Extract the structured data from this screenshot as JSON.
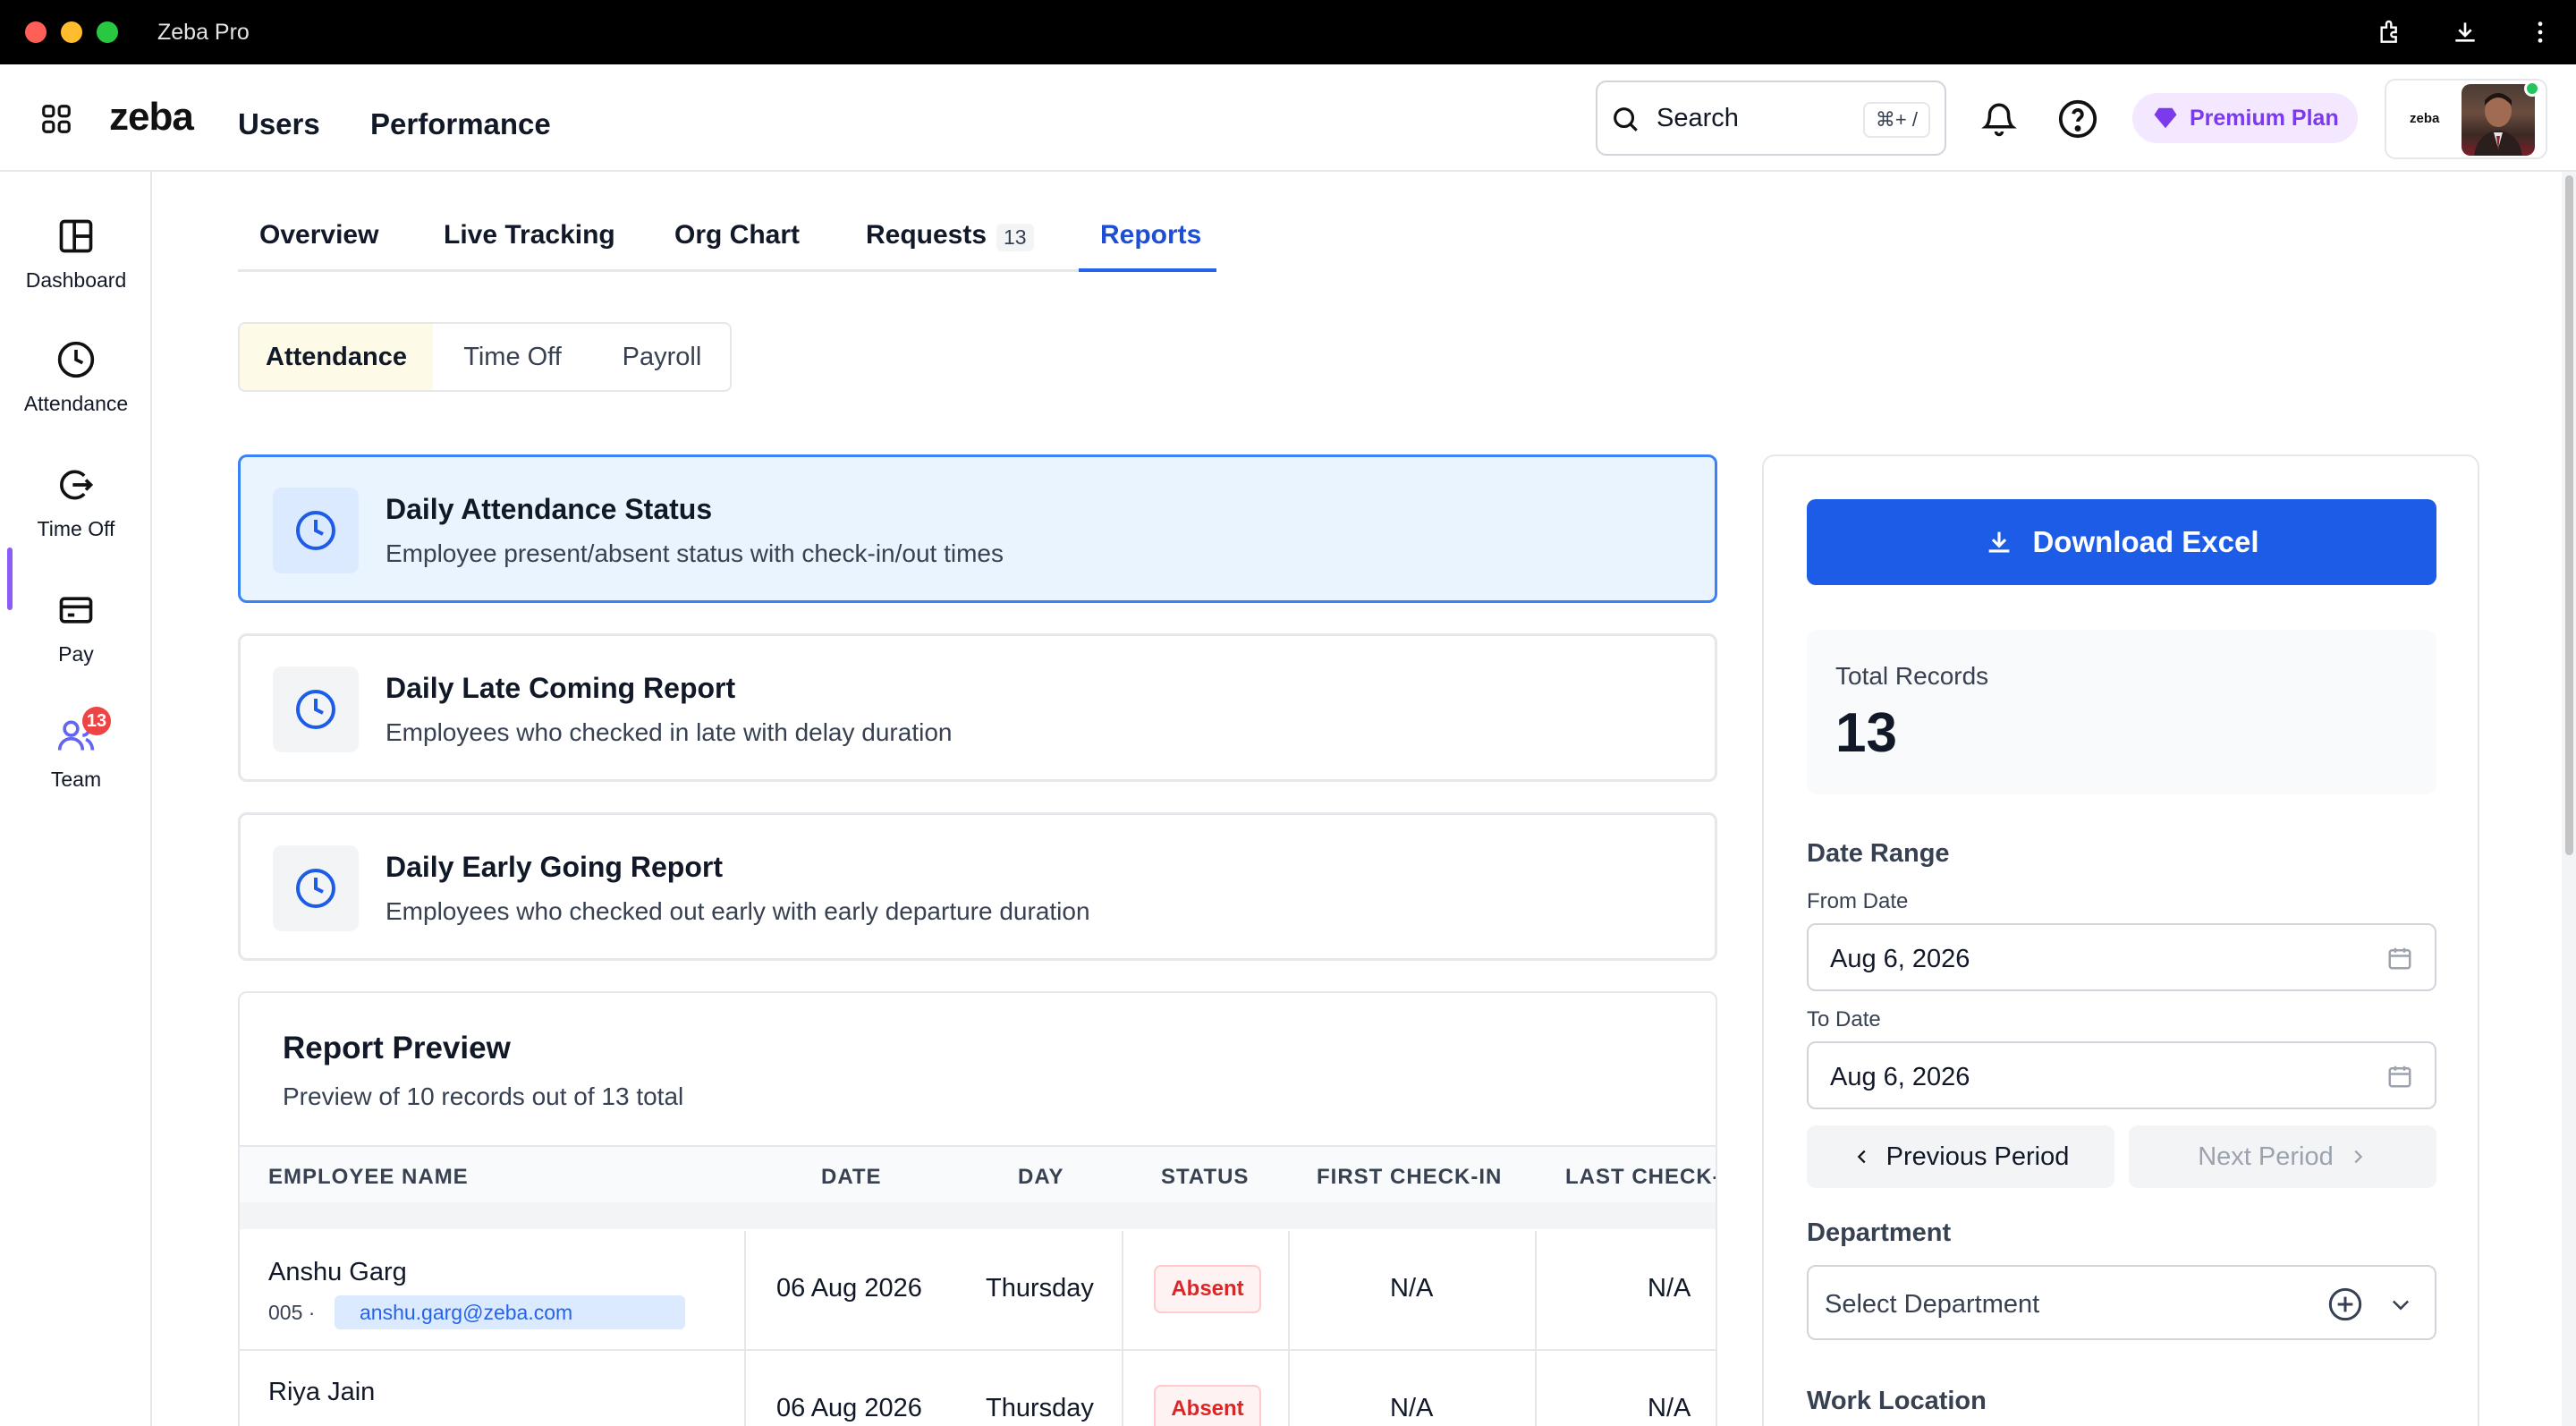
{
  "window": {
    "title": "Zeba Pro",
    "toolbar_icons": [
      "extension-icon",
      "download-icon",
      "more-vertical-icon"
    ]
  },
  "header": {
    "logo": "zeba",
    "nav": {
      "users": "Users",
      "performance": "Performance"
    },
    "search": {
      "label": "Search",
      "shortcut": "⌘+ /"
    },
    "premium_label": "Premium Plan",
    "profile_logo": "zeba"
  },
  "sidebar": {
    "items": [
      {
        "label": "Dashboard",
        "icon": "dashboard-icon"
      },
      {
        "label": "Attendance",
        "icon": "clock-icon"
      },
      {
        "label": "Time Off",
        "icon": "logout-icon"
      },
      {
        "label": "Pay",
        "icon": "wallet-icon"
      },
      {
        "label": "Team",
        "icon": "team-icon",
        "badge": "13",
        "active": true
      }
    ]
  },
  "tabs": {
    "items": [
      "Overview",
      "Live Tracking",
      "Org Chart",
      "Requests",
      "Reports"
    ],
    "requests_count": "13",
    "active": "Reports"
  },
  "subtabs": {
    "items": [
      "Attendance",
      "Time Off",
      "Payroll"
    ],
    "active": "Attendance"
  },
  "reports": [
    {
      "title": "Daily Attendance Status",
      "desc": "Employee present/absent status with check-in/out times",
      "selected": true
    },
    {
      "title": "Daily Late Coming Report",
      "desc": "Employees who checked in late with delay duration",
      "selected": false
    },
    {
      "title": "Daily Early Going Report",
      "desc": "Employees who checked out early with early departure duration",
      "selected": false
    }
  ],
  "preview": {
    "title": "Report Preview",
    "subtitle": "Preview of 10 records out of 13 total",
    "columns": [
      "EMPLOYEE NAME",
      "DATE",
      "DAY",
      "STATUS",
      "FIRST CHECK-IN",
      "LAST CHECK-"
    ],
    "rows": [
      {
        "name": "Anshu Garg",
        "id": "005 ·",
        "email": "anshu.garg@zeba.com",
        "date": "06 Aug 2026",
        "day": "Thursday",
        "status": "Absent",
        "first_checkin": "N/A",
        "last_checkout": "N/A"
      },
      {
        "name": "Riya Jain",
        "id": "",
        "email": "",
        "date": "06 Aug 2026",
        "day": "Thursday",
        "status": "Absent",
        "first_checkin": "N/A",
        "last_checkout": "N/A"
      }
    ]
  },
  "panel": {
    "download_label": "Download Excel",
    "total_label": "Total Records",
    "total_value": "13",
    "date_range_label": "Date Range",
    "from_label": "From Date",
    "from_value": "Aug 6, 2026",
    "to_label": "To Date",
    "to_value": "Aug 6, 2026",
    "prev_label": "Previous Period",
    "next_label": "Next Period",
    "department_label": "Department",
    "department_placeholder": "Select Department",
    "work_location_label": "Work Location"
  },
  "colors": {
    "accent": "#1d5ce6",
    "premium": "#7c3aed",
    "absent": "#dc2626",
    "selected_card_bg": "#eaf4fe"
  }
}
